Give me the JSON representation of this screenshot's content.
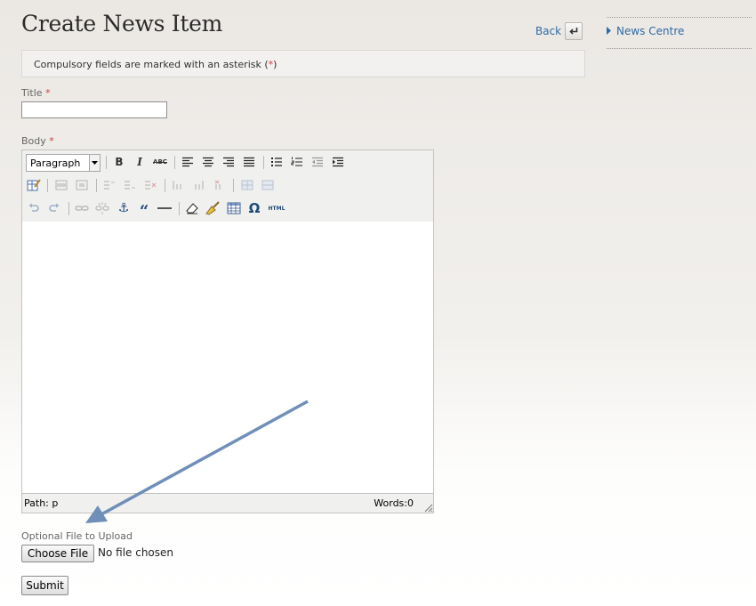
{
  "page": {
    "title": "Create News Item",
    "back_label": "Back"
  },
  "notice": {
    "text_before": "Compulsory fields are marked with an asterisk (",
    "asterisk": "*",
    "text_after": ")"
  },
  "form": {
    "title_label": "Title",
    "required_mark": "*",
    "title_value": "",
    "body_label": "Body",
    "file_label": "Optional File to Upload",
    "choose_file_label": "Choose File",
    "no_file_text": "No file chosen",
    "submit_label": "Submit"
  },
  "editor": {
    "format_value": "Paragraph",
    "row1": [
      "bold-icon",
      "italic-icon",
      "strikethrough-icon",
      "align-left-icon",
      "align-center-icon",
      "align-right-icon",
      "align-justify-icon",
      "bullet-list-icon",
      "numbered-list-icon",
      "outdent-icon",
      "indent-icon"
    ],
    "row2": [
      "edit-table-icon",
      "row-properties-icon",
      "cell-properties-icon",
      "insert-row-before-icon",
      "insert-row-after-icon",
      "delete-row-icon",
      "insert-column-before-icon",
      "insert-column-after-icon",
      "delete-column-icon",
      "split-cells-icon",
      "merge-cells-icon"
    ],
    "row3": [
      "undo-icon",
      "redo-icon",
      "link-icon",
      "unlink-icon",
      "anchor-icon",
      "blockquote-icon",
      "horizontal-rule-icon",
      "eraser-icon",
      "cleanup-icon",
      "table-icon",
      "special-character-icon",
      "html-source-icon"
    ],
    "bold_glyph": "B",
    "italic_glyph": "I",
    "strike_glyph": "ABC",
    "anchor_glyph": "⚓",
    "quote_glyph": "“",
    "omega_glyph": "Ω",
    "html_glyph": "HTML",
    "path_text": "Path: p",
    "words_text": "Words:0"
  },
  "sidebar": {
    "news_centre_label": "News Centre"
  },
  "colors": {
    "link": "#2f6aa3",
    "required": "#d23b3b",
    "annotation_arrow": "#6f8fb9"
  }
}
